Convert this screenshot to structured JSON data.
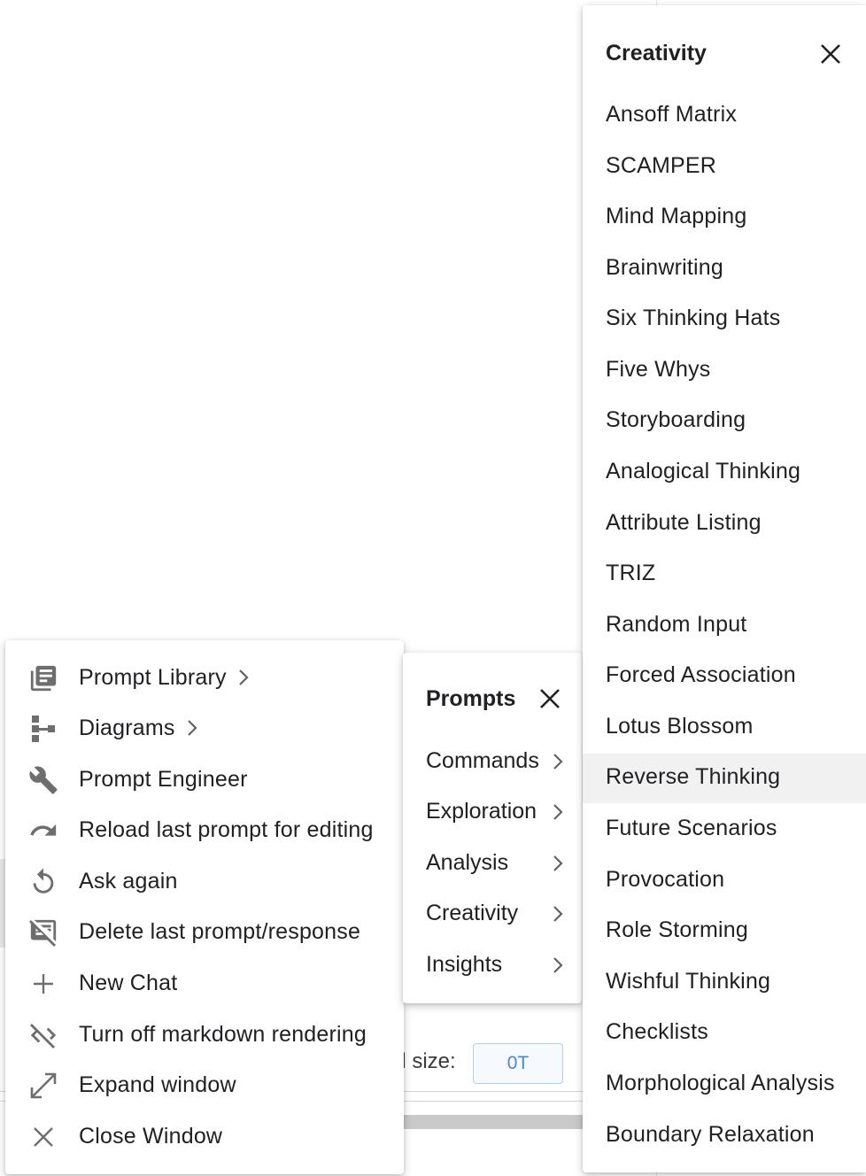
{
  "background": {
    "size_label": "al size:",
    "size_value": "0T"
  },
  "main_menu": {
    "items": [
      {
        "label": "Prompt Library",
        "icon": "library-books-icon",
        "submenu": true
      },
      {
        "label": "Diagrams",
        "icon": "account-tree-icon",
        "submenu": true
      },
      {
        "label": "Prompt Engineer",
        "icon": "wrench-icon",
        "submenu": false
      },
      {
        "label": "Reload last prompt for editing",
        "icon": "redo-icon",
        "submenu": false
      },
      {
        "label": "Ask again",
        "icon": "refresh-icon",
        "submenu": false
      },
      {
        "label": "Delete last prompt/response",
        "icon": "comment-off-icon",
        "submenu": false
      },
      {
        "label": "New Chat",
        "icon": "plus-icon",
        "submenu": false
      },
      {
        "label": "Turn off markdown rendering",
        "icon": "code-off-icon",
        "submenu": false
      },
      {
        "label": "Expand window",
        "icon": "expand-arrows-icon",
        "submenu": false
      },
      {
        "label": "Close Window",
        "icon": "close-icon",
        "submenu": false
      }
    ]
  },
  "prompts_menu": {
    "title": "Prompts",
    "items": [
      "Commands",
      "Exploration",
      "Analysis",
      "Creativity",
      "Insights"
    ]
  },
  "creativity_menu": {
    "title": "Creativity",
    "highlighted": "Reverse Thinking",
    "items": [
      "Ansoff Matrix",
      "SCAMPER",
      "Mind Mapping",
      "Brainwriting",
      "Six Thinking Hats",
      "Five Whys",
      "Storyboarding",
      "Analogical Thinking",
      "Attribute Listing",
      "TRIZ",
      "Random Input",
      "Forced Association",
      "Lotus Blossom",
      "Reverse Thinking",
      "Future Scenarios",
      "Provocation",
      "Role Storming",
      "Wishful Thinking",
      "Checklists",
      "Morphological Analysis",
      "Boundary Relaxation"
    ]
  },
  "colors": {
    "text": "#202124",
    "icon": "#6e6e6e",
    "highlight": "#f1f1f1",
    "accent_blue": "#4a88cc"
  }
}
